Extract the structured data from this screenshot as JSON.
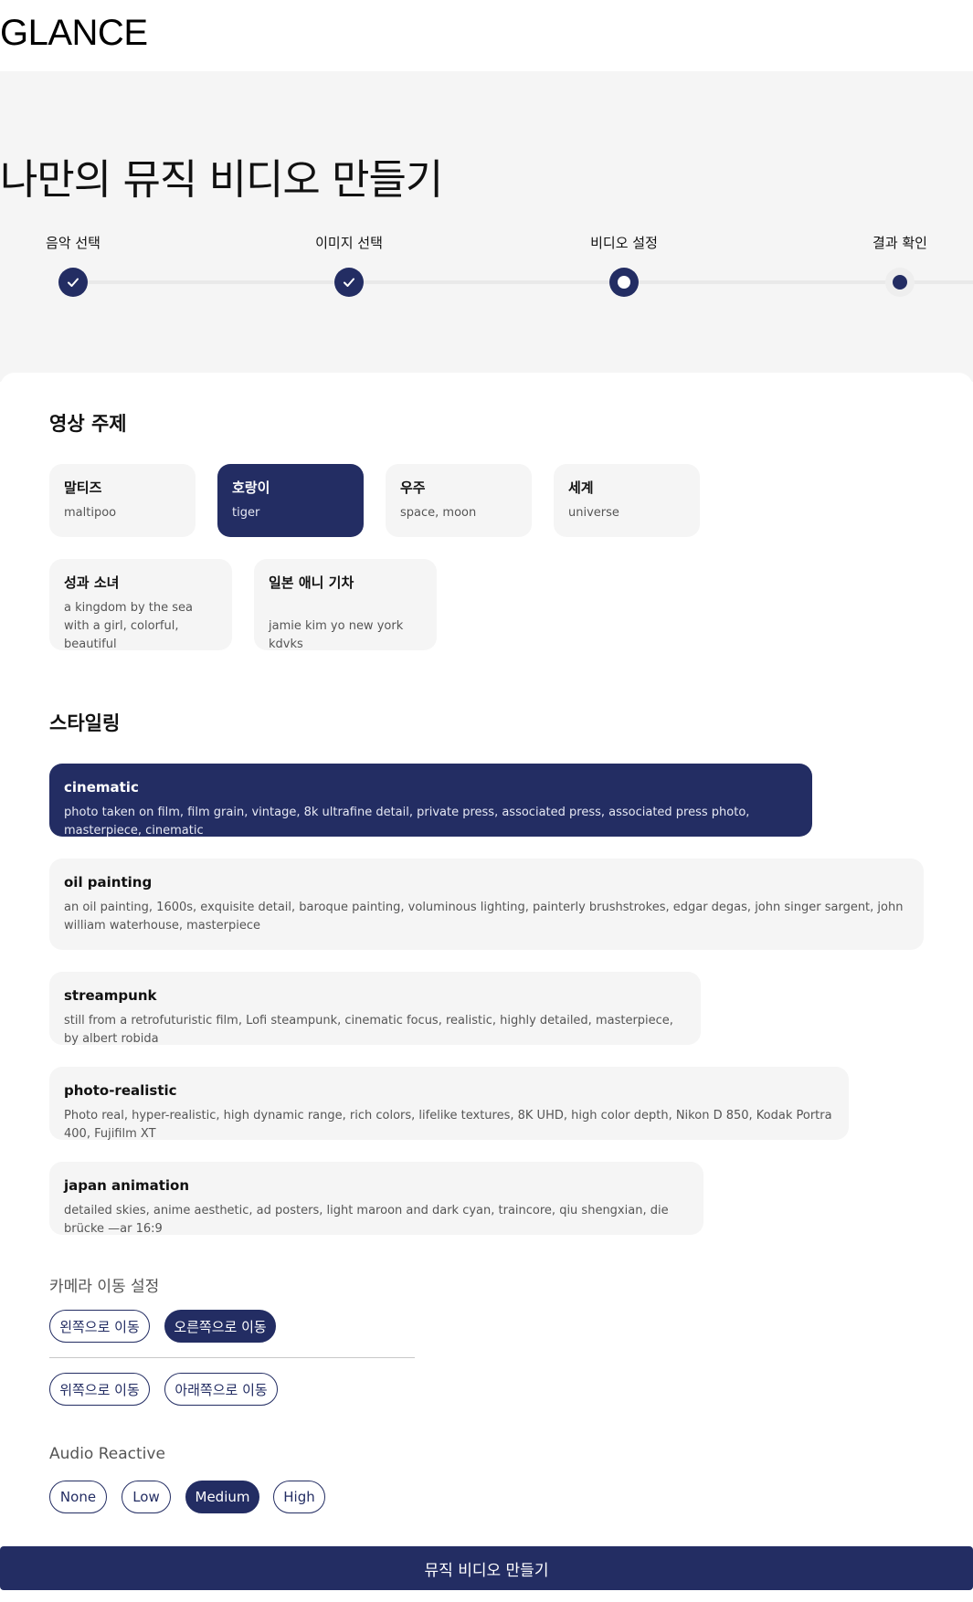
{
  "brand": {
    "logo": "GLANCE"
  },
  "page_title": "나만의 뮤직 비디오 만들기",
  "steps": [
    {
      "label": "음악 선택",
      "state": "done"
    },
    {
      "label": "이미지 선택",
      "state": "done"
    },
    {
      "label": "비디오 설정",
      "state": "current"
    },
    {
      "label": "결과 확인",
      "state": "upcoming"
    }
  ],
  "topic": {
    "title": "영상 주제",
    "options": [
      {
        "title": "말티즈",
        "desc": "maltipoo",
        "selected": false
      },
      {
        "title": "호랑이",
        "desc": "tiger",
        "selected": true
      },
      {
        "title": "우주",
        "desc": "space, moon",
        "selected": false
      },
      {
        "title": "세계",
        "desc": "universe",
        "selected": false
      },
      {
        "title": "성과 소녀",
        "desc": "a kingdom by the sea with a girl, colorful, beautiful",
        "selected": false
      },
      {
        "title": "일본 애니 기차",
        "desc": "jamie kim yo new york kdvks",
        "selected": false
      }
    ]
  },
  "styling": {
    "title": "스타일링",
    "options": [
      {
        "title": "cinematic",
        "desc": "photo taken on film, film grain, vintage, 8k ultrafine detail, private press, associated press, associated press photo, masterpiece, cinematic",
        "selected": true
      },
      {
        "title": "oil painting",
        "desc": "an oil painting, 1600s, exquisite detail, baroque painting, voluminous lighting, painterly brushstrokes, edgar degas, john singer sargent, john william waterhouse, masterpiece",
        "selected": false
      },
      {
        "title": "streampunk",
        "desc": "still from a retrofuturistic film, Lofi steampunk, cinematic focus, realistic, highly detailed, masterpiece, by albert robida",
        "selected": false
      },
      {
        "title": "photo-realistic",
        "desc": "Photo real, hyper-realistic, high dynamic range, rich colors, lifelike textures, 8K UHD, high color depth, Nikon D 850, Kodak Portra 400, Fujifilm XT",
        "selected": false
      },
      {
        "title": "japan animation",
        "desc": "detailed skies, anime aesthetic, ad posters, light maroon and dark cyan, traincore, qiu shengxian, die brücke —ar 16:9",
        "selected": false
      }
    ]
  },
  "camera": {
    "title": "카메라 이동 설정",
    "horizontal": [
      {
        "label": "왼쪽으로 이동",
        "selected": false
      },
      {
        "label": "오른쪽으로 이동",
        "selected": true
      }
    ],
    "vertical": [
      {
        "label": "위쪽으로 이동",
        "selected": false
      },
      {
        "label": "아래쪽으로 이동",
        "selected": false
      }
    ]
  },
  "audio": {
    "title": "Audio Reactive",
    "options": [
      {
        "label": "None",
        "selected": false
      },
      {
        "label": "Low",
        "selected": false
      },
      {
        "label": "Medium",
        "selected": true
      },
      {
        "label": "High",
        "selected": false
      }
    ]
  },
  "submit": {
    "label": "뮤직 비디오 만들기"
  },
  "colors": {
    "primary": "#232d63",
    "surface": "#f5f5f5",
    "text": "#111111",
    "muted": "#555555"
  }
}
